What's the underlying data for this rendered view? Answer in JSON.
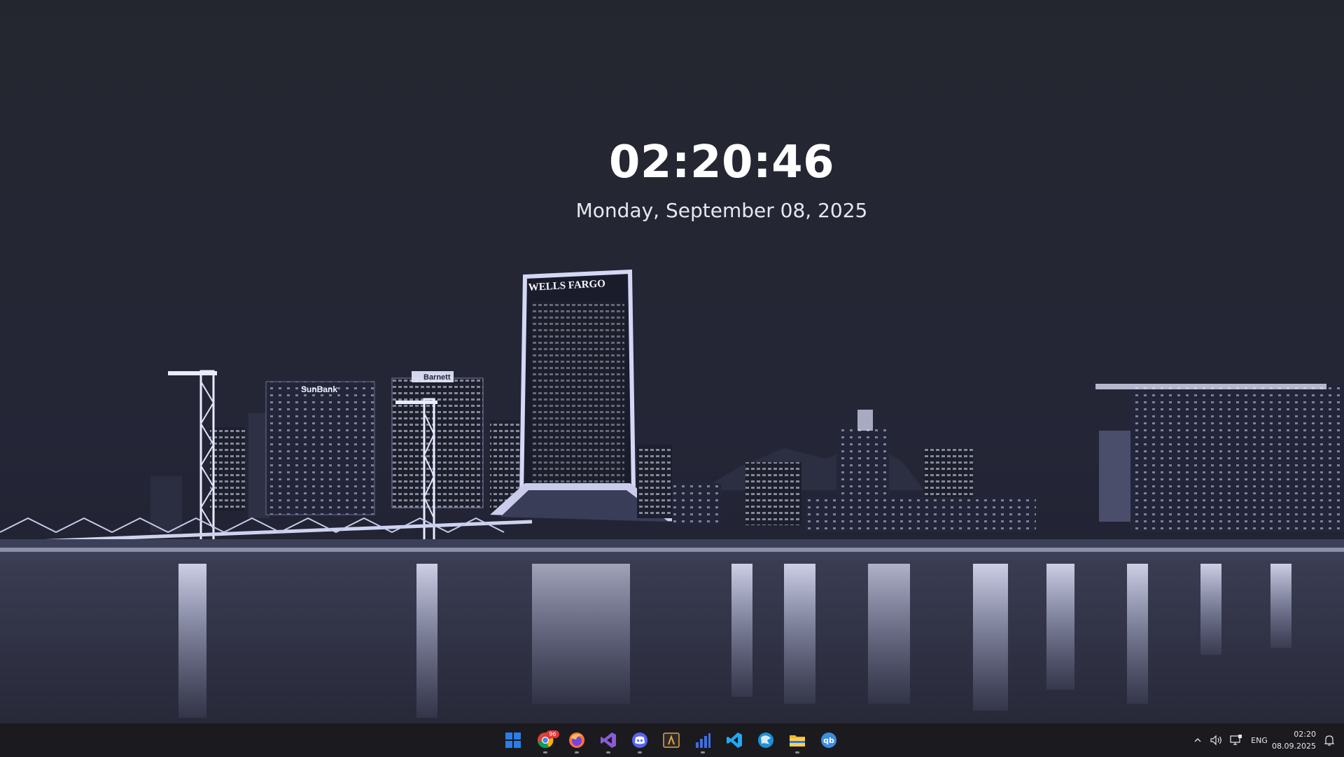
{
  "clock": {
    "time": "02:20:46",
    "date": "Monday, September 08, 2025"
  },
  "wallpaper": {
    "description": "",
    "signs": {
      "tower": "WELLS FARGO",
      "bank_left": "SunBank",
      "bank_mid": "Barnett"
    },
    "colors": {
      "sky": "#24262f",
      "water": "#2b2c3a",
      "lights": "#e9ecff"
    }
  },
  "taskbar": {
    "apps": [
      {
        "name": "Start",
        "icon": "windows-icon",
        "running": false
      },
      {
        "name": "Chrome",
        "icon": "chrome-icon",
        "running": true,
        "badge": "96"
      },
      {
        "name": "Firefox",
        "icon": "firefox-icon",
        "running": true
      },
      {
        "name": "Visual Studio",
        "icon": "visual-studio-icon",
        "running": true
      },
      {
        "name": "Discord",
        "icon": "discord-icon",
        "running": true
      },
      {
        "name": "Terminal",
        "icon": "terminal-icon",
        "running": false
      },
      {
        "name": "Monitor",
        "icon": "bar-chart-icon",
        "running": true
      },
      {
        "name": "VS Code",
        "icon": "vscode-icon",
        "running": false
      },
      {
        "name": "Browser",
        "icon": "globe-icon",
        "running": false
      },
      {
        "name": "File Explorer",
        "icon": "folder-icon",
        "running": true
      },
      {
        "name": "qBittorrent",
        "icon": "qbittorrent-icon",
        "running": false
      }
    ],
    "tray": {
      "language": "ENG",
      "time": "02:20",
      "date": "08.09.2025"
    }
  },
  "colors": {
    "taskbar_bg": "#1b1b1f",
    "accent": "#2b7de9"
  }
}
